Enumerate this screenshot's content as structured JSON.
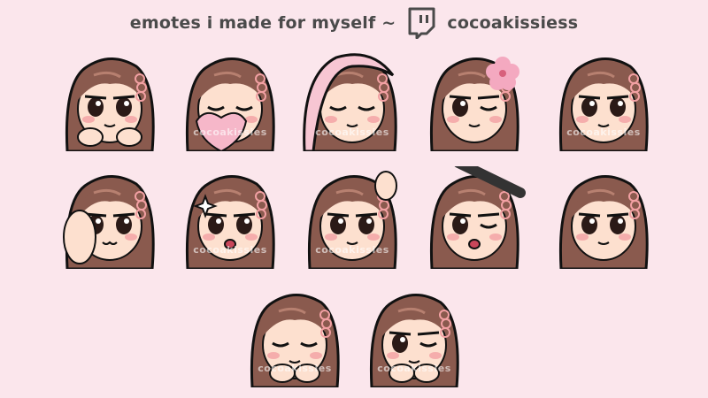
{
  "header": {
    "title": "emotes i made for myself ~",
    "platform_icon": "twitch-icon",
    "username": "cocoakissiess"
  },
  "colors": {
    "background": "#fbe6ec",
    "hair": "#8a5a4e",
    "hair_light": "#b78070",
    "skin": "#fde0cf",
    "blush": "#f2a0a3",
    "outline": "#111111",
    "heart": "#f6b7c9",
    "flower": "#f4a9c0",
    "hood": "#f7c6d3",
    "text": "#4a4a4a"
  },
  "emotes": [
    {
      "name": "emote-hands-under-chin",
      "watermark": ""
    },
    {
      "name": "emote-heart-hug",
      "watermark": "cocoakissies"
    },
    {
      "name": "emote-hood-cozy",
      "watermark": "cocoakissies"
    },
    {
      "name": "emote-flower",
      "watermark": ""
    },
    {
      "name": "emote-side-look",
      "watermark": "cocoakissies"
    },
    {
      "name": "emote-foot",
      "watermark": ""
    },
    {
      "name": "emote-sparkle-surprised",
      "watermark": "cocoakissies"
    },
    {
      "name": "emote-wave",
      "watermark": "cocoakissies"
    },
    {
      "name": "emote-microphone",
      "watermark": ""
    },
    {
      "name": "emote-peek",
      "watermark": ""
    },
    {
      "name": "emote-giggle",
      "watermark": "cocoakissies"
    },
    {
      "name": "emote-sleepy",
      "watermark": "cocoakissies"
    }
  ]
}
